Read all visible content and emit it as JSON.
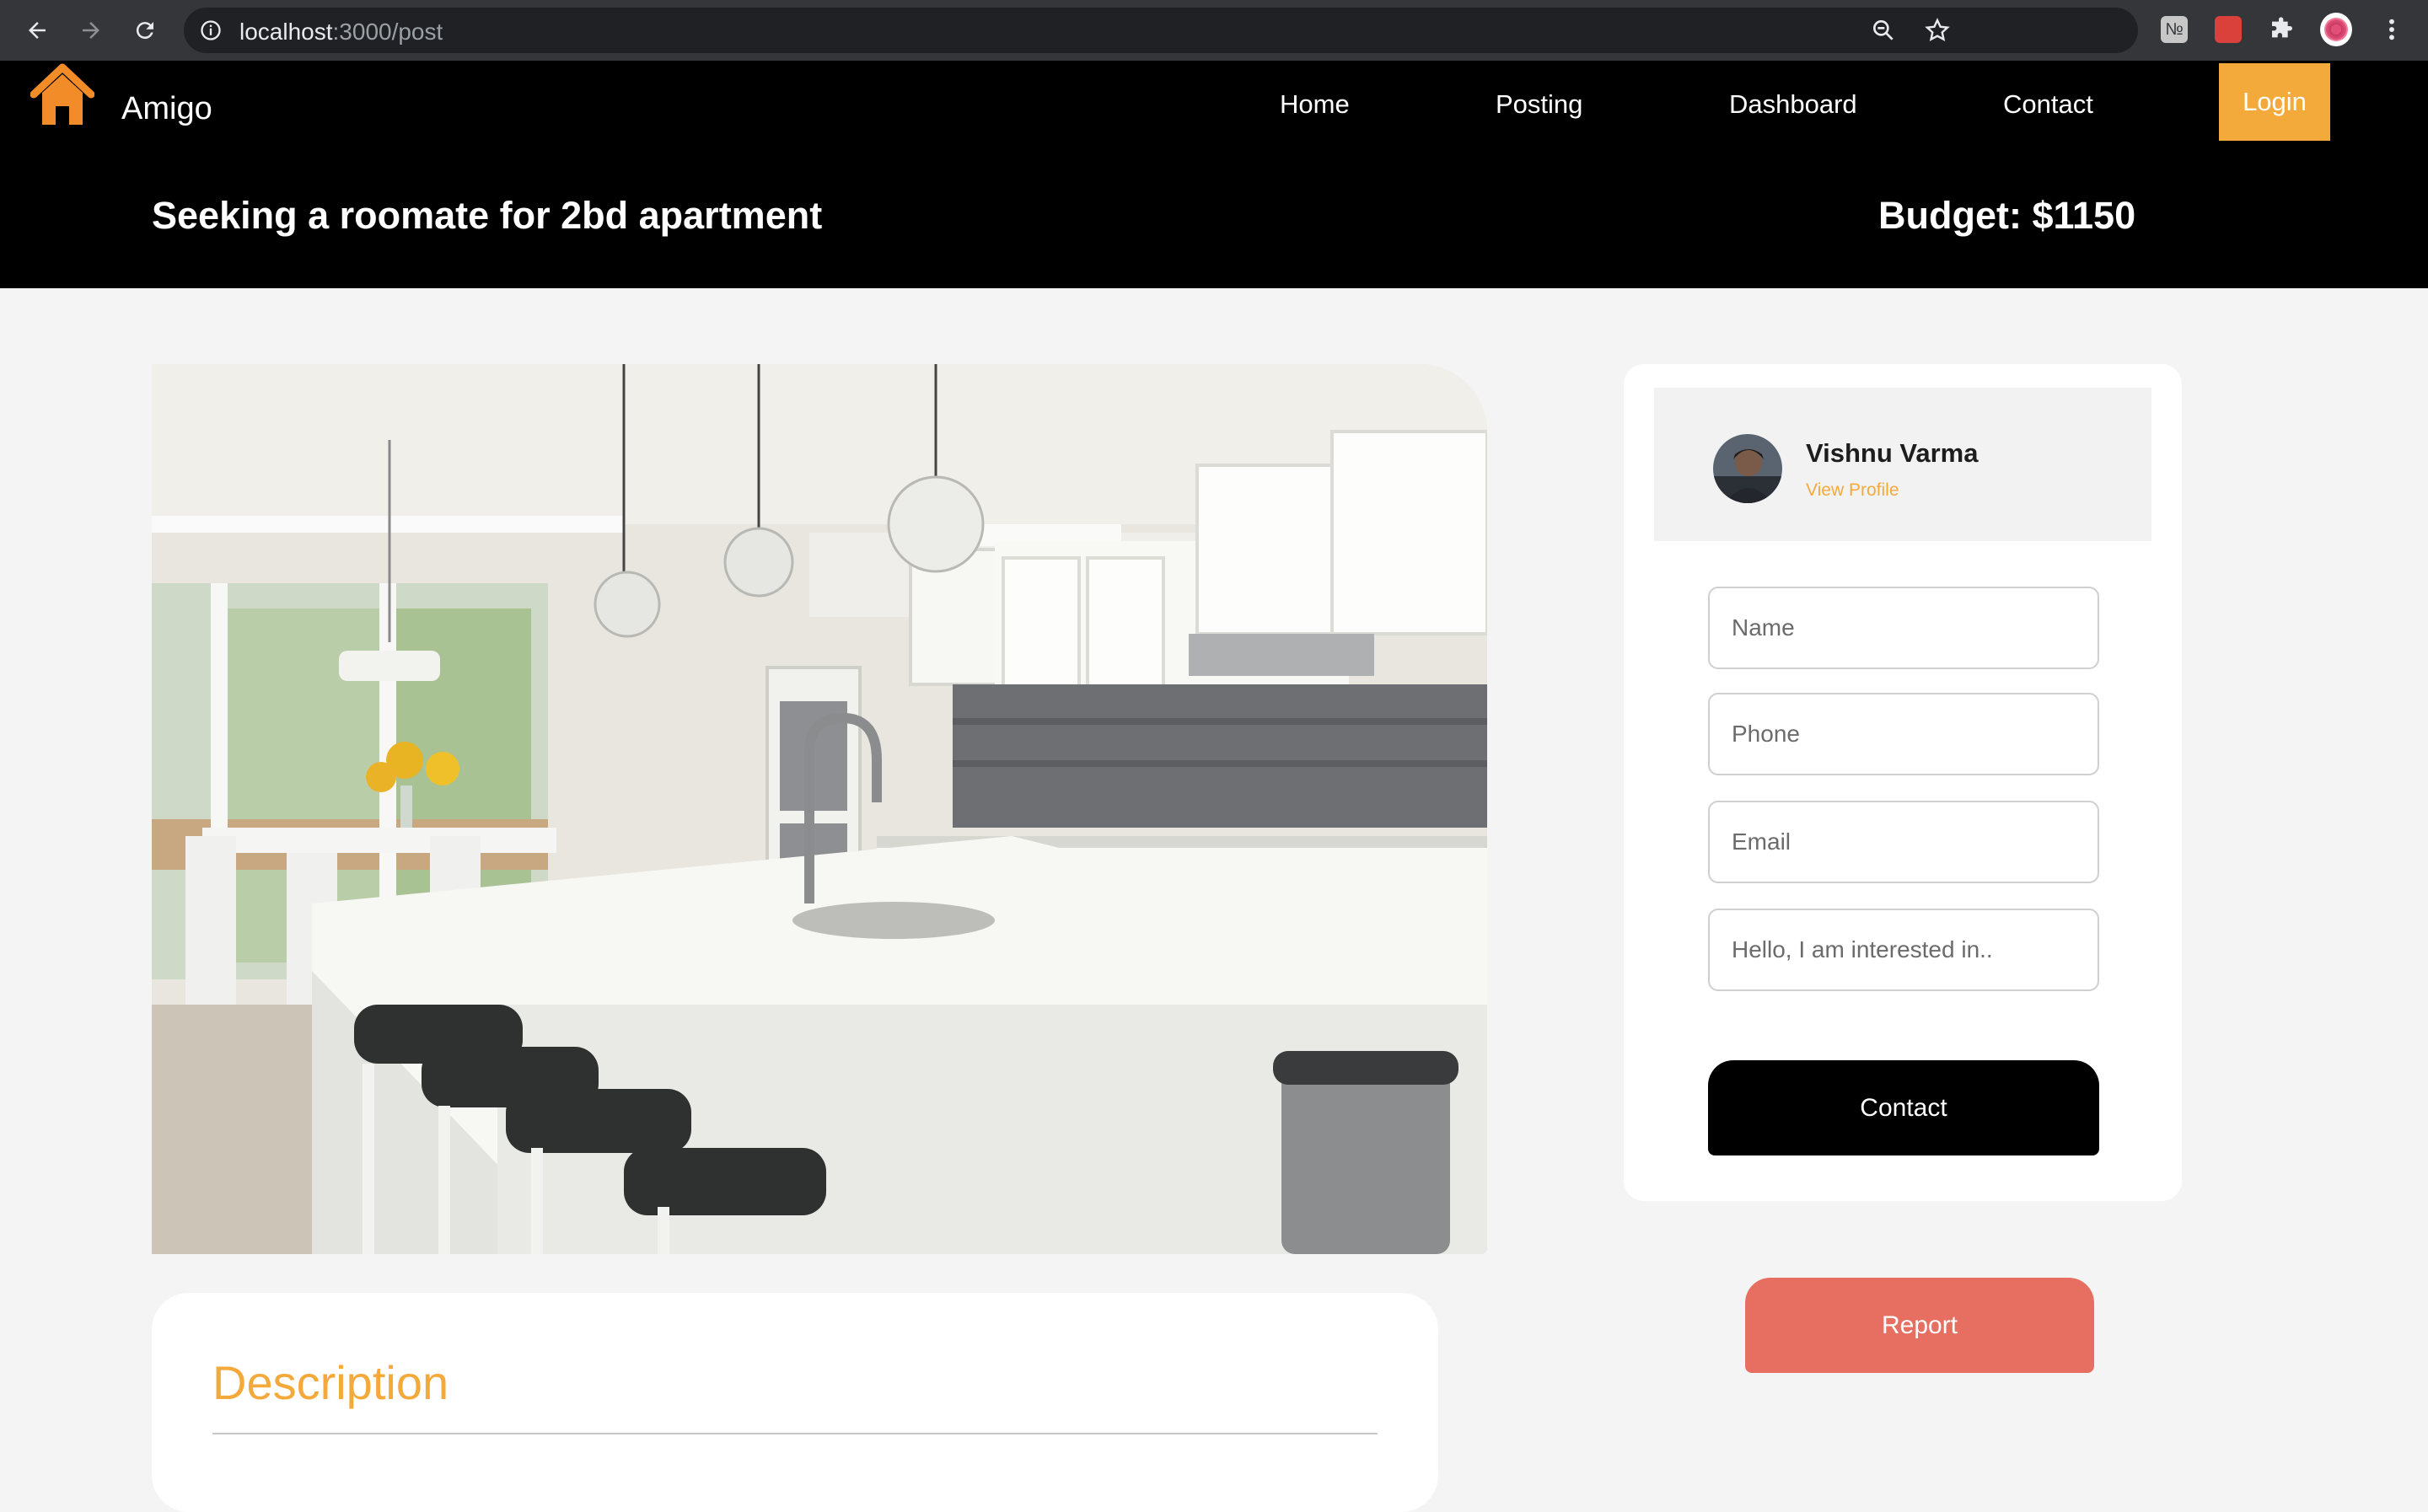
{
  "browser": {
    "url_host": "localhost",
    "url_path": ":3000/post",
    "back_icon": "arrow-left-icon",
    "forward_icon": "arrow-right-icon",
    "reload_icon": "reload-icon"
  },
  "header": {
    "brand": "Amigo",
    "logo_icon": "house-icon",
    "nav": [
      "Home",
      "Posting",
      "Dashboard",
      "Contact"
    ],
    "login_label": "Login",
    "post_title": "Seeking a roomate for 2bd apartment",
    "budget": "Budget: $1150"
  },
  "profile": {
    "name": "Vishnu Varma",
    "link_label": "View Profile"
  },
  "form": {
    "name_placeholder": "Name",
    "phone_placeholder": "Phone",
    "email_placeholder": "Email",
    "message_placeholder": "Hello, I am interested in..",
    "contact_label": "Contact"
  },
  "report_label": "Report",
  "description": {
    "title": "Description"
  },
  "colors": {
    "accent": "#f4a93b",
    "report": "#e76f61",
    "header_bg": "#000000",
    "page_bg": "#f4f4f4"
  }
}
